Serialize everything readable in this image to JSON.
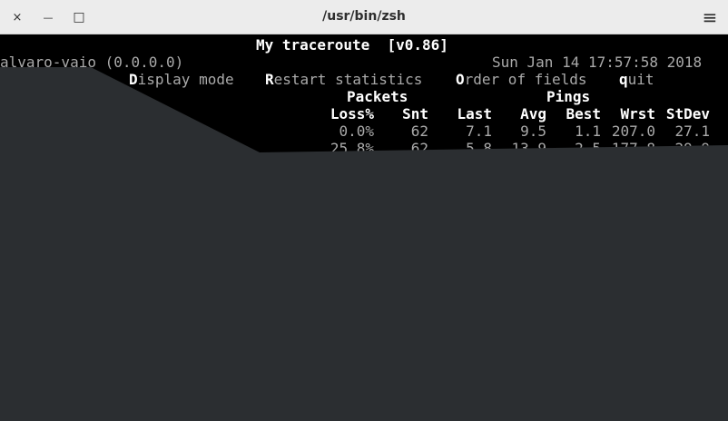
{
  "window": {
    "title": "/usr/bin/zsh",
    "close_glyph": "×",
    "minimize_glyph": "—",
    "maximize_glyph": "□",
    "menu_glyph": "≡"
  },
  "mtr": {
    "heading": "My traceroute  [v0.86]",
    "host": "alvaro-vaio (0.0.0.0)",
    "datetime": "Sun Jan 14 17:57:58 2018",
    "keys": [
      {
        "hotkey": "D",
        "rest": "isplay mode"
      },
      {
        "hotkey": "R",
        "rest": "estart statistics"
      },
      {
        "hotkey": "O",
        "rest": "rder of fields"
      },
      {
        "hotkey": "q",
        "rest": "uit"
      }
    ],
    "group_packets": "Packets",
    "group_pings": "Pings",
    "columns": [
      "Loss%",
      "Snt",
      "Last",
      "Avg",
      "Best",
      "Wrst",
      "StDev"
    ],
    "rows": [
      [
        "0.0%",
        "62",
        "7.1",
        "9.5",
        "1.1",
        "207.0",
        "27.1"
      ],
      [
        "25.8%",
        "62",
        "5.8",
        "13.9",
        "2.5",
        "177.8",
        "29.9"
      ]
    ]
  },
  "colors": {
    "titlebar": "#ececec",
    "terminal_bg": "#000000",
    "overlay": "#2b2e31",
    "text_dim": "#aaaaaa",
    "text_bright": "#ffffff"
  }
}
